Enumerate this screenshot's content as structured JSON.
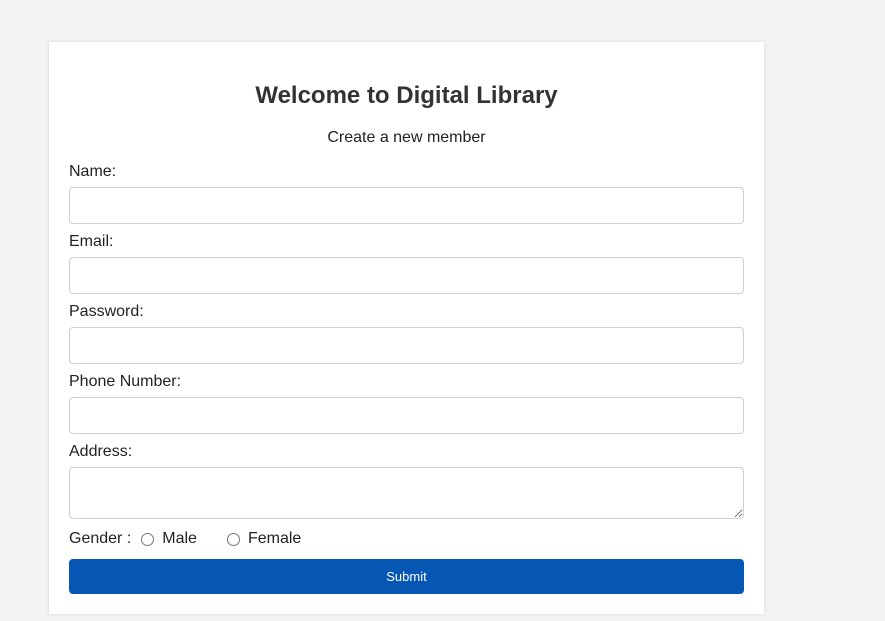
{
  "form": {
    "title": "Welcome to Digital Library",
    "subtitle": "Create a new member",
    "fields": {
      "name": {
        "label": "Name:",
        "value": "",
        "placeholder": ""
      },
      "email": {
        "label": "Email:",
        "value": "",
        "placeholder": ""
      },
      "password": {
        "label": "Password:",
        "value": "",
        "placeholder": ""
      },
      "phone": {
        "label": "Phone Number:",
        "value": "",
        "placeholder": ""
      },
      "address": {
        "label": "Address:",
        "value": "",
        "placeholder": ""
      }
    },
    "gender": {
      "label": "Gender :",
      "options": [
        "Male",
        "Female"
      ],
      "selected": null
    },
    "submit_label": "Submit"
  },
  "colors": {
    "background": "#f3f3f3",
    "card": "#ffffff",
    "submit_button": "#0656b4",
    "text": "#222222"
  }
}
